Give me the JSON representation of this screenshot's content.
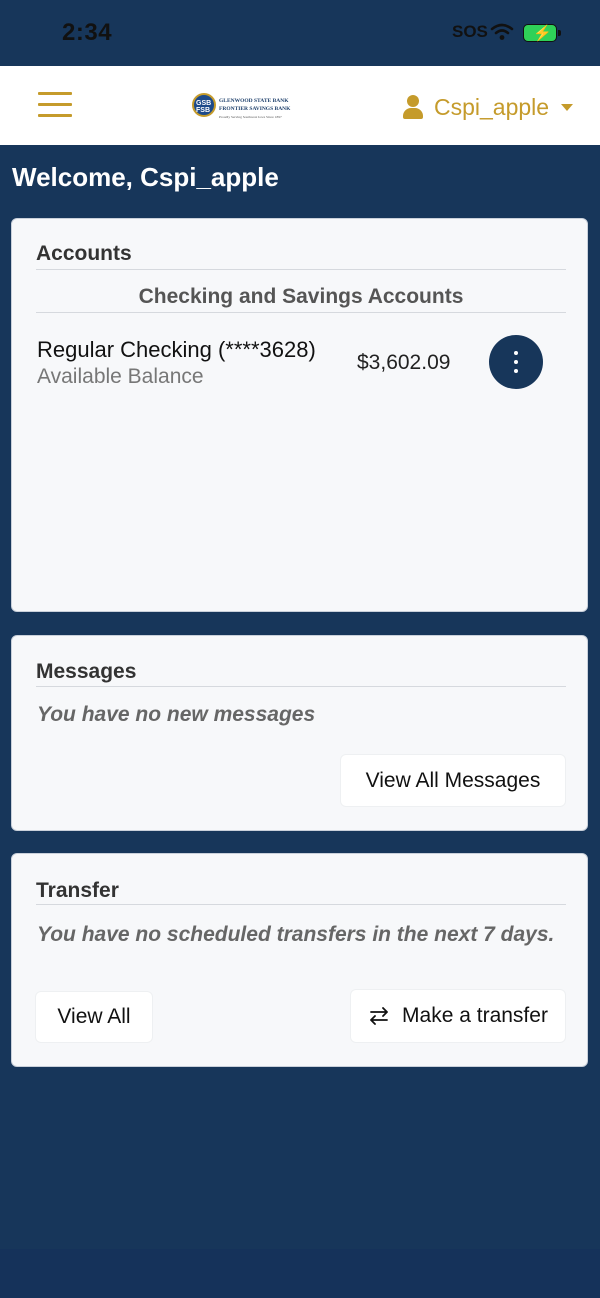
{
  "status_bar": {
    "time": "2:34",
    "carrier": "SOS"
  },
  "header": {
    "logo": {
      "badge": "GSB FSB",
      "line1": "GLENWOOD STATE BANK",
      "line2": "FRONTIER SAVINGS BANK",
      "line3": "Proudly Serving Southwest Iowa Since 1897"
    },
    "user_name": "Cspi_apple"
  },
  "welcome": "Welcome, Cspi_apple",
  "accounts": {
    "title": "Accounts",
    "subheading": "Checking and Savings Accounts",
    "items": [
      {
        "name": "Regular Checking (****3628)",
        "sub_label": "Available Balance",
        "balance": "$3,602.09"
      }
    ]
  },
  "messages": {
    "title": "Messages",
    "empty_text": "You have no new messages",
    "view_all_label": "View All Messages"
  },
  "transfer": {
    "title": "Transfer",
    "empty_text": "You have no scheduled transfers in the next 7 days.",
    "view_all_label": "View All",
    "make_transfer_label": "Make a transfer"
  },
  "colors": {
    "navy": "#17365a",
    "gold": "#c59b2b",
    "card": "#f7f8fa"
  },
  "icons": [
    "hamburger-icon",
    "user-icon",
    "caret-down-icon",
    "kebab-icon",
    "transfer-arrows-icon",
    "wifi-icon",
    "battery-icon"
  ]
}
